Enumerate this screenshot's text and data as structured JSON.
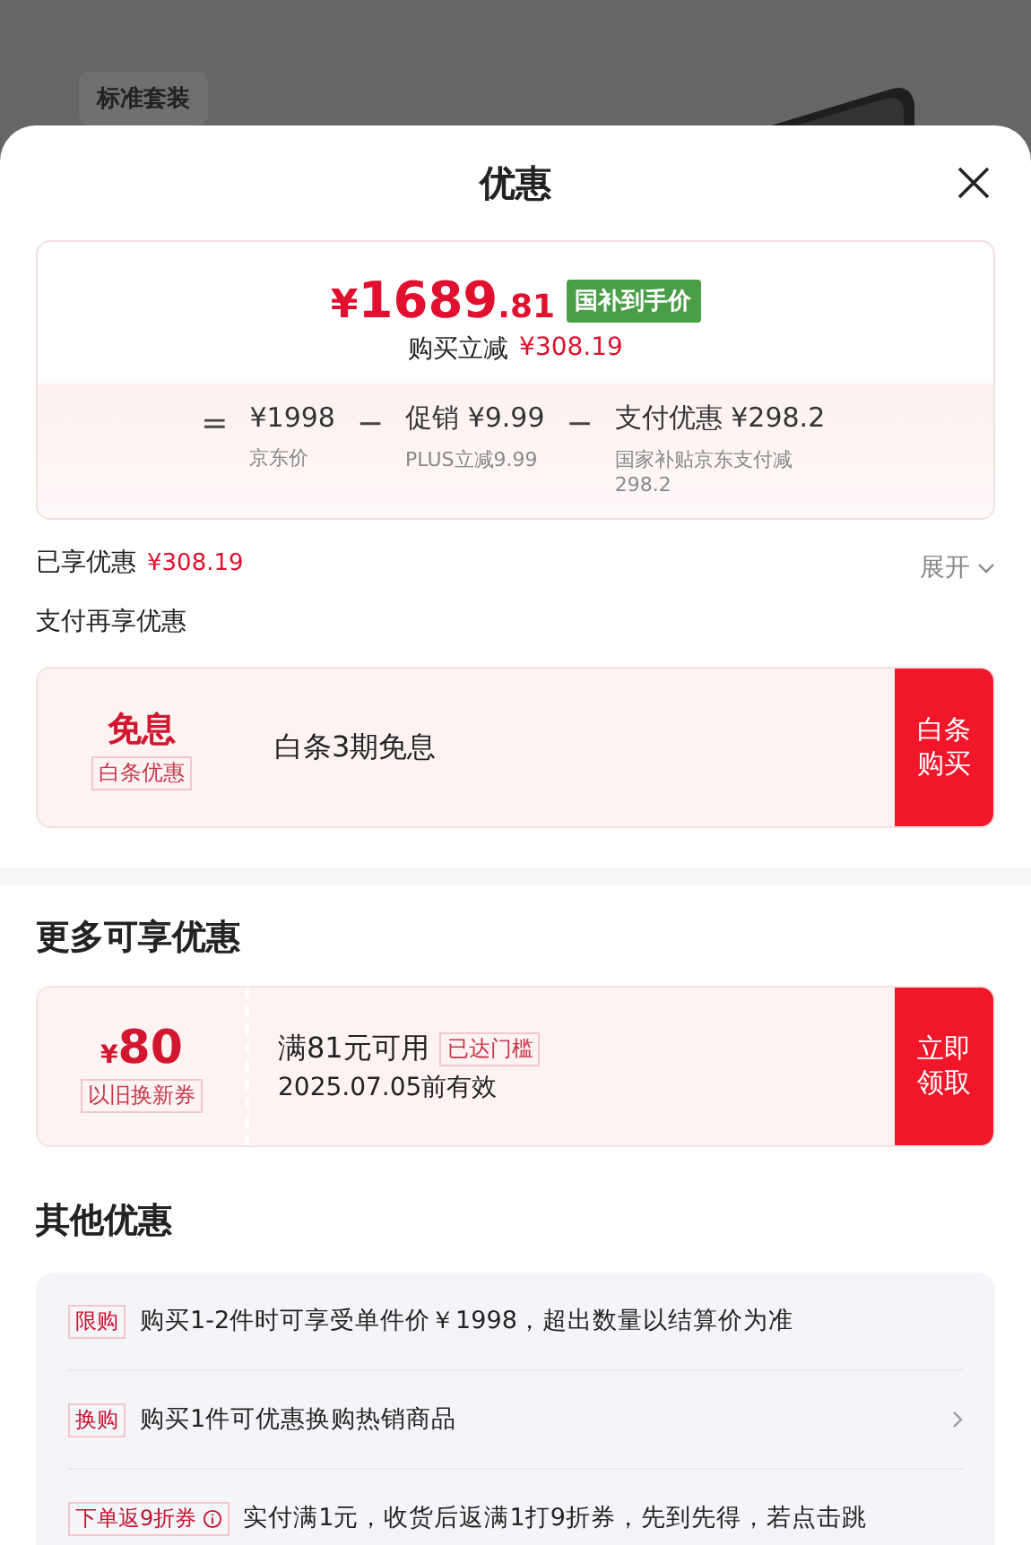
{
  "background": {
    "chip": "标准套装"
  },
  "sheet": {
    "title": "优惠",
    "price_card": {
      "currency": "¥",
      "price_int": "1689",
      "price_dec": ".81",
      "badge": "国补到手价",
      "saving_label": "购买立减",
      "saving": "¥308.19",
      "breakdown": [
        {
          "op": "=",
          "value": "¥1998",
          "note": "京东价"
        },
        {
          "op": "−",
          "value": "促销 ¥9.99",
          "note": "PLUS立减9.99"
        },
        {
          "op": "−",
          "value": "支付优惠 ¥298.2",
          "note": "国家补贴京东支付减298.2"
        }
      ]
    },
    "enjoyed": {
      "label": "已享优惠",
      "amount": "¥308.19",
      "toggle": "展开"
    },
    "pay_section": {
      "title": "支付再享优惠",
      "offer": {
        "headline": "免息",
        "tag": "白条优惠",
        "text": "白条3期免息",
        "button": "白条购买"
      }
    },
    "more_section": {
      "title": "更多可享优惠",
      "coupon": {
        "currency": "¥",
        "amount": "80",
        "tag": "以旧换新券",
        "condition": "满81元可用",
        "status": "已达门槛",
        "validity": "2025.07.05前有效",
        "button": "立即领取"
      }
    },
    "other_section": {
      "title": "其他优惠",
      "rows": [
        {
          "tag": "限购",
          "text": "购买1-2件时可享受单件价￥1998，超出数量以结算价为准",
          "has_arrow": false,
          "has_info": false
        },
        {
          "tag": "换购",
          "text": "购买1件可优惠换购热销商品",
          "has_arrow": true,
          "has_info": false
        },
        {
          "tag": "下单返9折券",
          "text": "实付满1元，收货后返满1打9折券，先到先得，若点击跳",
          "has_arrow": false,
          "has_info": true
        }
      ]
    }
  }
}
